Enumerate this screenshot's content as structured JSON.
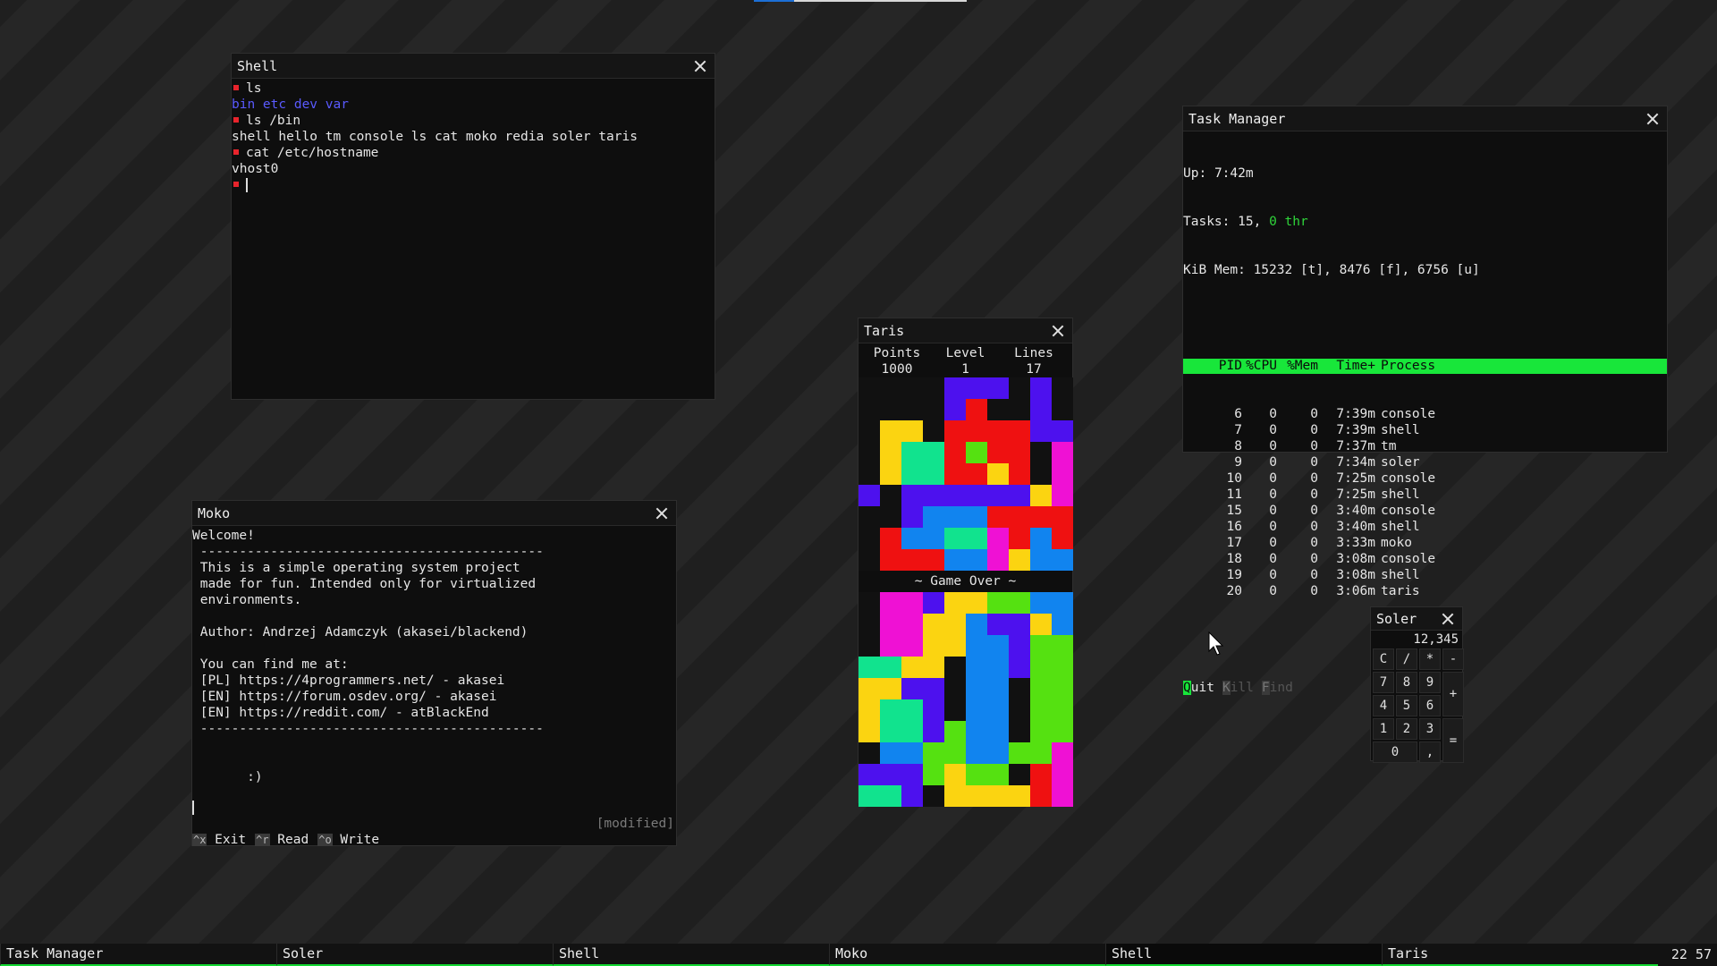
{
  "colors": {
    "accent": "#18e63a",
    "prompt": "#e8242c",
    "dirs": "#5a5aff",
    "green_text": "#2fd53a",
    "topbar": "#1c6fd6"
  },
  "shell": {
    "title": "Shell",
    "lines": [
      {
        "prompt": true,
        "text": "ls"
      },
      {
        "prompt": false,
        "text": "bin etc dev var",
        "color": "dirs"
      },
      {
        "prompt": true,
        "text": "ls /bin"
      },
      {
        "prompt": false,
        "text": "shell hello tm console ls cat moko redia soler taris"
      },
      {
        "prompt": true,
        "text": "cat /etc/hostname"
      },
      {
        "prompt": false,
        "text": "vhost0"
      },
      {
        "prompt": true,
        "text": "",
        "cursor": true
      }
    ]
  },
  "task_manager": {
    "title": "Task Manager",
    "uptime_label": "Up:",
    "uptime": "7:42m",
    "tasks_label": "Tasks:",
    "tasks": "15,",
    "threads": "0 thr",
    "mem_label": "KiB Mem:",
    "mem": "15232 [t], 8476 [f], 6756 [u]",
    "headers": [
      "PID",
      "%CPU",
      "%Mem",
      "Time+",
      "Process"
    ],
    "rows": [
      {
        "pid": "6",
        "cpu": "0",
        "mem": "0",
        "time": "7:39m",
        "proc": "console"
      },
      {
        "pid": "7",
        "cpu": "0",
        "mem": "0",
        "time": "7:39m",
        "proc": "shell"
      },
      {
        "pid": "8",
        "cpu": "0",
        "mem": "0",
        "time": "7:37m",
        "proc": "tm"
      },
      {
        "pid": "9",
        "cpu": "0",
        "mem": "0",
        "time": "7:34m",
        "proc": "soler"
      },
      {
        "pid": "10",
        "cpu": "0",
        "mem": "0",
        "time": "7:25m",
        "proc": "console"
      },
      {
        "pid": "11",
        "cpu": "0",
        "mem": "0",
        "time": "7:25m",
        "proc": "shell"
      },
      {
        "pid": "15",
        "cpu": "0",
        "mem": "0",
        "time": "3:40m",
        "proc": "console"
      },
      {
        "pid": "16",
        "cpu": "0",
        "mem": "0",
        "time": "3:40m",
        "proc": "shell"
      },
      {
        "pid": "17",
        "cpu": "0",
        "mem": "0",
        "time": "3:33m",
        "proc": "moko"
      },
      {
        "pid": "18",
        "cpu": "0",
        "mem": "0",
        "time": "3:08m",
        "proc": "console"
      },
      {
        "pid": "19",
        "cpu": "0",
        "mem": "0",
        "time": "3:08m",
        "proc": "shell"
      },
      {
        "pid": "20",
        "cpu": "0",
        "mem": "0",
        "time": "3:06m",
        "proc": "taris"
      }
    ],
    "menu": [
      {
        "key": "Q",
        "rest": "uit",
        "enabled": true
      },
      {
        "key": "K",
        "rest": "ill",
        "enabled": false
      },
      {
        "key": "F",
        "rest": "ind",
        "enabled": false
      }
    ]
  },
  "taris": {
    "title": "Taris",
    "points_label": "Points",
    "points": "1000",
    "level_label": "Level",
    "level": "1",
    "lines_label": "Lines",
    "lines": "17",
    "game_over": "~ Game Over ~",
    "palette": {
      "P": "#4d11ee",
      "R": "#ef1111",
      "Y": "#fbd411",
      "G": "#55e111",
      "C": "#11e38e",
      "B": "#1184ef",
      "M": "#ef11d4",
      ".": "#111111"
    },
    "top_rows": [
      "....PPP.P.",
      "....PR..P.",
      ".YY.RRRRPP",
      ".YCCRGRR.M",
      ".YCCRRYR.M",
      "P.PPPPPPYM",
      "..PBBBRRRR",
      ".RBBCCMRBR",
      ".RRRBBMYBB"
    ],
    "bottom_rows": [
      ".MMPYYGGBB",
      ".MMYYBPPYB",
      ".MMYYBBPGG",
      "CCYY.BBPGG",
      "YYPP.BB.GG",
      "YCCP.BB.GG",
      "YCCPGBB.GG",
      ".BBGGBBGGM",
      "PPPGYGG.RM",
      "CCP.YYYYRM"
    ]
  },
  "moko": {
    "title": "Moko",
    "lines": [
      "Welcome!",
      " --------------------------------------------",
      " This is a simple operating system project",
      " made for fun. Intended only for virtualized",
      " environments.",
      "",
      " Author: Andrzej Adamczyk (akasei/blackend)",
      "",
      " You can find me at:",
      " [PL] https://4programmers.net/ - akasei",
      " [EN] https://forum.osdev.org/ - akasei",
      " [EN] https://reddit.com/ - atBlackEnd",
      " --------------------------------------------",
      "",
      "",
      "       :)"
    ],
    "status": "[modified]",
    "shortcuts": [
      {
        "key": "^x",
        "label": "Exit"
      },
      {
        "key": "^r",
        "label": "Read"
      },
      {
        "key": "^o",
        "label": "Write"
      }
    ]
  },
  "soler": {
    "title": "Soler",
    "display": "12,345",
    "keys": [
      "C",
      "/",
      "*",
      "-",
      "7",
      "8",
      "9",
      "+",
      "4",
      "5",
      "6",
      "1",
      "2",
      "3",
      "=",
      "0",
      ","
    ]
  },
  "taskbar": {
    "items": [
      "Task Manager",
      "Soler",
      "Shell",
      "Moko",
      "Shell",
      "Taris"
    ],
    "active_index": 4,
    "clock": "22 57"
  }
}
